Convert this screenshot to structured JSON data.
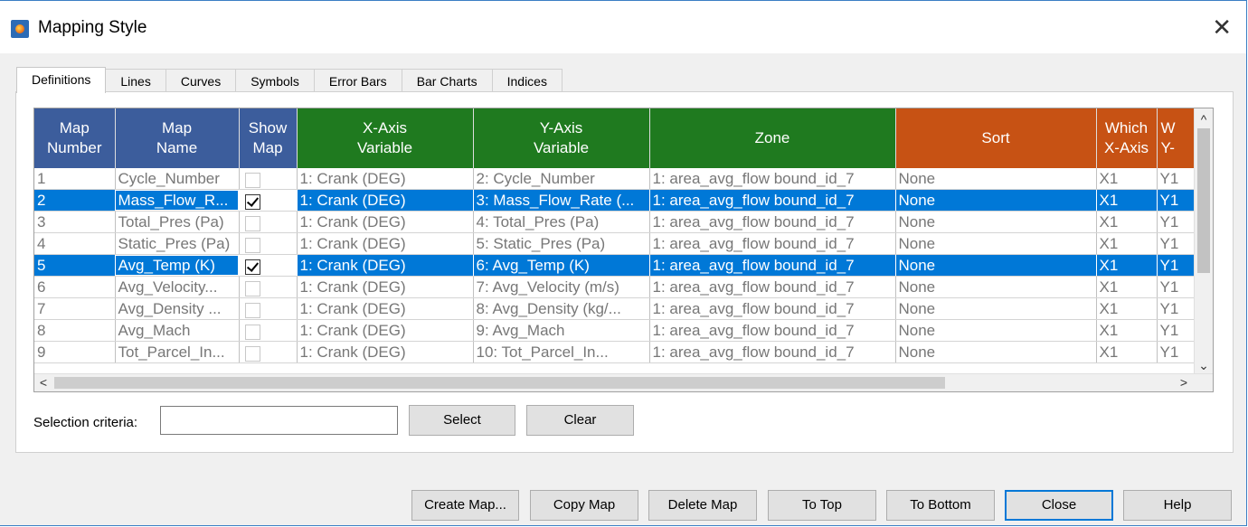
{
  "window": {
    "title": "Mapping Style",
    "close_label": "✕"
  },
  "tabs": [
    "Definitions",
    "Lines",
    "Curves",
    "Symbols",
    "Error Bars",
    "Bar Charts",
    "Indices"
  ],
  "grid": {
    "headers": {
      "map_number": [
        "Map",
        "Number"
      ],
      "map_name": [
        "Map",
        "Name"
      ],
      "show_map": [
        "Show",
        "Map"
      ],
      "x_axis_var": [
        "X-Axis",
        "Variable"
      ],
      "y_axis_var": [
        "Y-Axis",
        "Variable"
      ],
      "zone": "Zone",
      "sort": "Sort",
      "which_x_axis": [
        "Which",
        "X-Axis"
      ],
      "which_y_axis": [
        "W",
        "Y-"
      ]
    },
    "rows": [
      {
        "num": "1",
        "name": "Cycle_Number",
        "show": false,
        "x": "1: Crank (DEG)",
        "y": "2: Cycle_Number",
        "zone": "1: area_avg_flow bound_id_7",
        "sort": "None",
        "xa": "X1",
        "ya": "Y1",
        "selected": false
      },
      {
        "num": "2",
        "name": "Mass_Flow_R...",
        "show": true,
        "x": "1: Crank (DEG)",
        "y": "3: Mass_Flow_Rate (...",
        "zone": "1: area_avg_flow bound_id_7",
        "sort": "None",
        "xa": "X1",
        "ya": "Y1",
        "selected": true
      },
      {
        "num": "3",
        "name": "Total_Pres (Pa)",
        "show": false,
        "x": "1: Crank (DEG)",
        "y": "4: Total_Pres (Pa)",
        "zone": "1: area_avg_flow bound_id_7",
        "sort": "None",
        "xa": "X1",
        "ya": "Y1",
        "selected": false
      },
      {
        "num": "4",
        "name": "Static_Pres (Pa)",
        "show": false,
        "x": "1: Crank (DEG)",
        "y": "5: Static_Pres (Pa)",
        "zone": "1: area_avg_flow bound_id_7",
        "sort": "None",
        "xa": "X1",
        "ya": "Y1",
        "selected": false
      },
      {
        "num": "5",
        "name": "Avg_Temp (K)",
        "show": true,
        "x": "1: Crank (DEG)",
        "y": "6: Avg_Temp (K)",
        "zone": "1: area_avg_flow bound_id_7",
        "sort": "None",
        "xa": "X1",
        "ya": "Y1",
        "selected": true
      },
      {
        "num": "6",
        "name": "Avg_Velocity...",
        "show": false,
        "x": "1: Crank (DEG)",
        "y": "7: Avg_Velocity (m/s)",
        "zone": "1: area_avg_flow bound_id_7",
        "sort": "None",
        "xa": "X1",
        "ya": "Y1",
        "selected": false
      },
      {
        "num": "7",
        "name": "Avg_Density ...",
        "show": false,
        "x": "1: Crank (DEG)",
        "y": "8: Avg_Density (kg/...",
        "zone": "1: area_avg_flow bound_id_7",
        "sort": "None",
        "xa": "X1",
        "ya": "Y1",
        "selected": false
      },
      {
        "num": "8",
        "name": "Avg_Mach",
        "show": false,
        "x": "1: Crank (DEG)",
        "y": "9: Avg_Mach",
        "zone": "1: area_avg_flow bound_id_7",
        "sort": "None",
        "xa": "X1",
        "ya": "Y1",
        "selected": false
      },
      {
        "num": "9",
        "name": "Tot_Parcel_In...",
        "show": false,
        "x": "1: Crank (DEG)",
        "y": "10: Tot_Parcel_In...",
        "zone": "1: area_avg_flow bound_id_7",
        "sort": "None",
        "xa": "X1",
        "ya": "Y1",
        "selected": false
      }
    ]
  },
  "selection": {
    "label": "Selection criteria:",
    "value": "",
    "select_button": "Select",
    "clear_button": "Clear"
  },
  "buttons": {
    "create_map": "Create Map...",
    "copy_map": "Copy Map",
    "delete_map": "Delete Map",
    "to_top": "To Top",
    "to_bottom": "To Bottom",
    "close": "Close",
    "help": "Help"
  },
  "colors": {
    "header_blue": "#3c5d9c",
    "header_green": "#1f7a1f",
    "header_orange": "#c75214",
    "selection": "#0078d7"
  }
}
